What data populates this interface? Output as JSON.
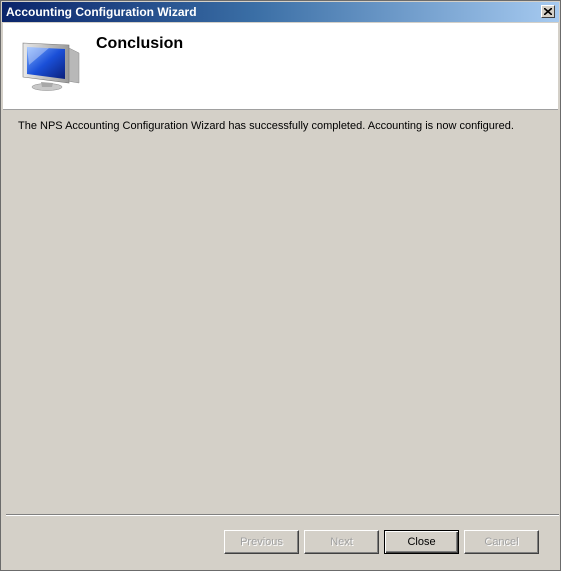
{
  "window": {
    "title": "Accounting Configuration Wizard",
    "close_glyph": "×"
  },
  "header": {
    "title": "Conclusion",
    "icon": "computer-monitor-icon"
  },
  "main": {
    "message": "The NPS Accounting Configuration Wizard has successfully completed. Accounting is now configured."
  },
  "buttons": {
    "previous": "Previous",
    "next": "Next",
    "close": "Close",
    "cancel": "Cancel"
  },
  "colors": {
    "titlebar_start": "#0a246a",
    "titlebar_end": "#a6caf0",
    "dialog_bg": "#d4d0c8",
    "header_bg": "#ffffff"
  }
}
